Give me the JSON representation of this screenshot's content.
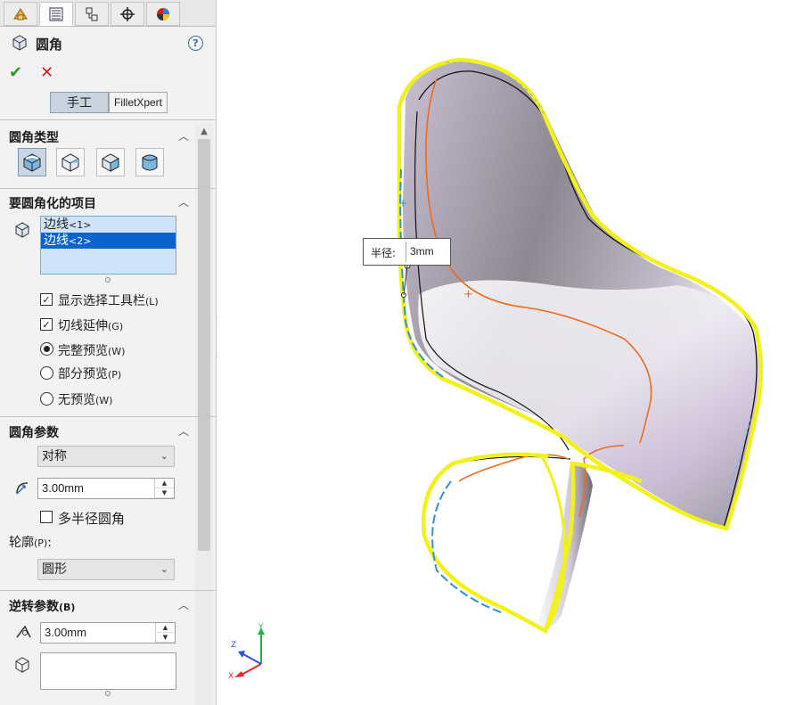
{
  "feature": {
    "title": "圆角",
    "help_icon": "?"
  },
  "actions": {
    "ok_icon": "✔",
    "cancel_icon": "✕"
  },
  "mode_toggle": {
    "manual": "手工",
    "expert": "FilletXpert"
  },
  "sections": {
    "fillet_type": {
      "title": "圆角类型",
      "options": [
        "constant-size-fillet-icon",
        "variable-size-fillet-icon",
        "face-fillet-icon",
        "full-round-fillet-icon"
      ],
      "selected": 0
    },
    "items": {
      "title": "要圆角化的项目",
      "list": [
        {
          "name": "边线",
          "suffix": "<1>"
        },
        {
          "name": "边线",
          "suffix": "<2>"
        }
      ],
      "selected_index": 1,
      "options": [
        {
          "label": "显示选择工具栏",
          "shortcut": "(L)",
          "type": "checkbox",
          "checked": true
        },
        {
          "label": "切线延伸",
          "shortcut": "(G)",
          "type": "checkbox",
          "checked": true
        },
        {
          "label": "完整预览",
          "shortcut": "(W)",
          "type": "radio",
          "checked": true
        },
        {
          "label": "部分预览",
          "shortcut": "(P)",
          "type": "radio",
          "checked": false
        },
        {
          "label": "无预览",
          "shortcut": "(W)",
          "type": "radio",
          "checked": false
        }
      ]
    },
    "parameters": {
      "title": "圆角参数",
      "method": "对称",
      "radius": "3.00mm",
      "multi_radius_label": "多半径圆角",
      "multi_radius_checked": false,
      "profile_label": "轮廓",
      "profile_shortcut": "(P)",
      "profile_colon": ":",
      "profile": "圆形"
    },
    "setback": {
      "title": "逆转参数",
      "shortcut": "(B)",
      "distance": "3.00mm"
    }
  },
  "viewport": {
    "callout_label": "半径:",
    "callout_value": "3mm",
    "triad": {
      "x": "X",
      "y": "Y",
      "z": "Z"
    },
    "colors": {
      "highlight": "#f2f21a",
      "edge_orange": "#ec6b1c",
      "edge_blue": "#2f8fe0",
      "surface": "#d7d2de"
    }
  },
  "caret": "⌄",
  "collapse_icon": "︿"
}
